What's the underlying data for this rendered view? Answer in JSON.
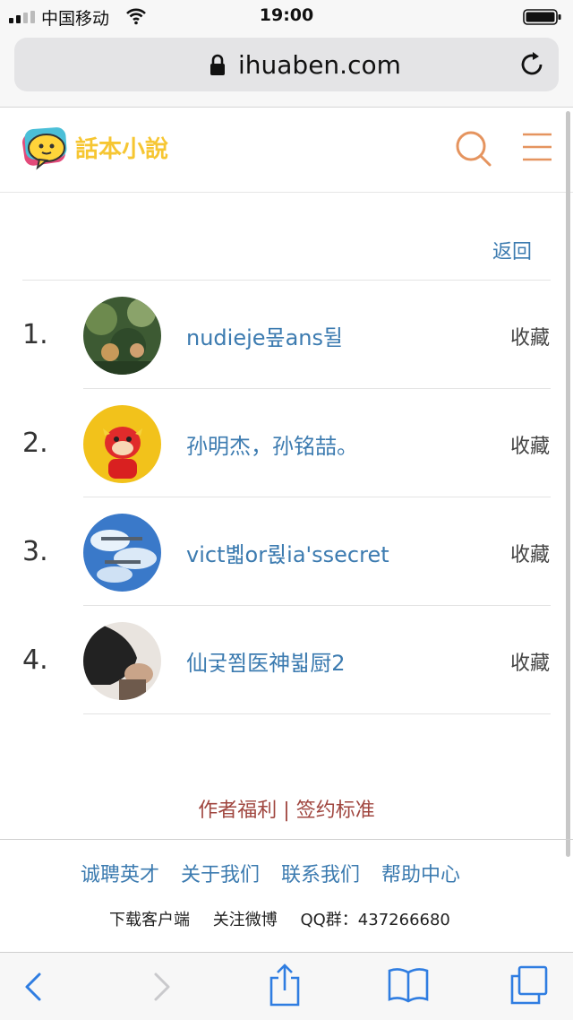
{
  "status_bar": {
    "carrier": "中国移动",
    "time": "19:00"
  },
  "browser": {
    "url": "ihuaben.com"
  },
  "header": {
    "logo_text": "話本小說"
  },
  "content": {
    "back_label": "返回",
    "items": [
      {
        "rank": "1.",
        "name": "nudieje뫂ans뒬",
        "action": "收藏"
      },
      {
        "rank": "2.",
        "name": "孙明杰，孙铭喆。",
        "action": "收藏"
      },
      {
        "rank": "3.",
        "name": "vict볣or뢵ia'ssecret",
        "action": "收藏"
      },
      {
        "rank": "4.",
        "name": "仙궃쬠医神뷟厨2",
        "action": "收藏"
      }
    ]
  },
  "footer": {
    "author_links": "作者福利 | 签约标准",
    "nav": [
      "诚聘英才",
      "关于我们",
      "联系我们",
      "帮助中心"
    ],
    "download": "下载客户端",
    "weibo": "关注微博",
    "qq": "QQ群：437266680"
  }
}
